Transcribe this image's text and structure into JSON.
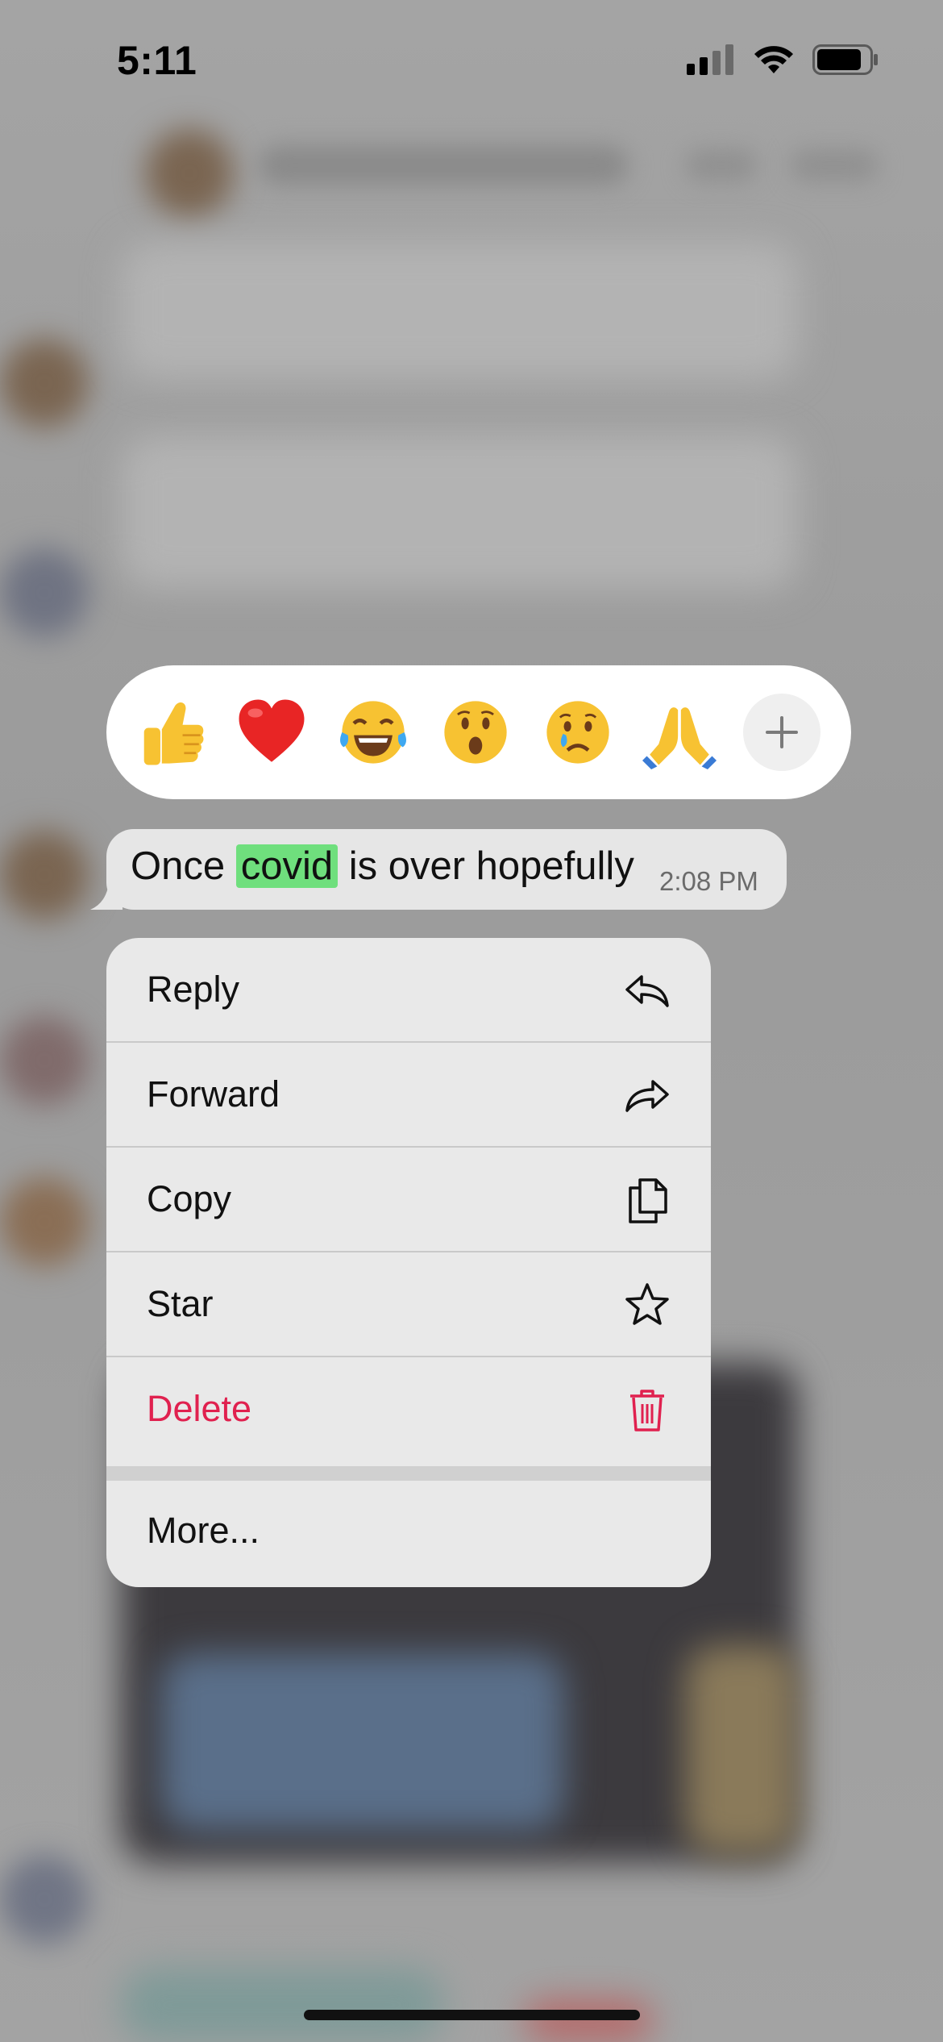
{
  "status_bar": {
    "time": "5:11",
    "battery_level": 0.85
  },
  "reactions": {
    "emojis": [
      {
        "name": "thumbs-up-emoji"
      },
      {
        "name": "red-heart-emoji"
      },
      {
        "name": "tears-of-joy-emoji"
      },
      {
        "name": "surprised-face-emoji"
      },
      {
        "name": "crying-face-emoji"
      },
      {
        "name": "folded-hands-emoji"
      }
    ],
    "more_icon": "plus-icon"
  },
  "message": {
    "text_before": "Once ",
    "highlight": "covid",
    "text_after": " is over hopefully",
    "time": "2:08 PM"
  },
  "menu": {
    "items": [
      {
        "label": "Reply",
        "icon": "reply-icon"
      },
      {
        "label": "Forward",
        "icon": "forward-icon"
      },
      {
        "label": "Copy",
        "icon": "copy-icon"
      },
      {
        "label": "Star",
        "icon": "star-icon"
      },
      {
        "label": "Delete",
        "icon": "trash-icon",
        "color": "#e0214f"
      }
    ],
    "more_label": "More..."
  },
  "colors": {
    "highlight": "#6fdf7d",
    "destructive": "#e0214f"
  }
}
